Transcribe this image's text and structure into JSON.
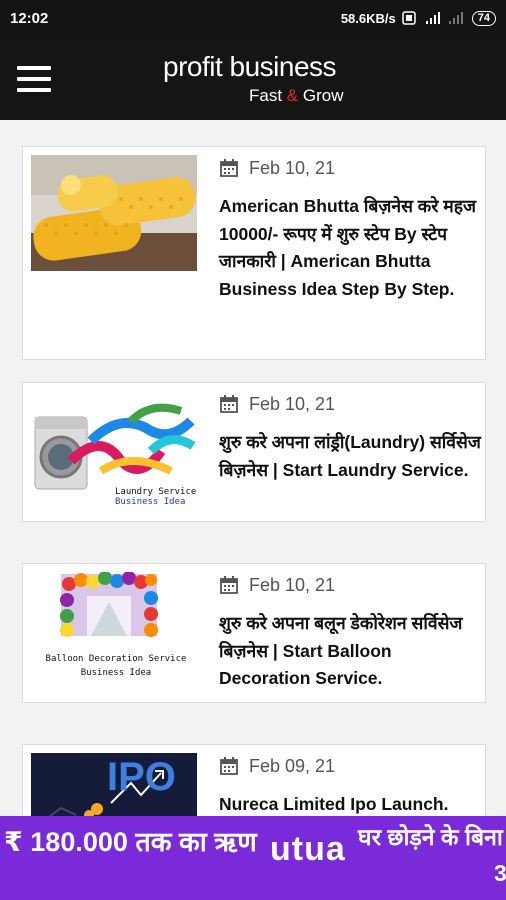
{
  "status_bar": {
    "time": "12:02",
    "network_speed": "58.6KB/s",
    "battery": "74"
  },
  "header": {
    "title": "profit business",
    "tagline_left": "Fast",
    "tagline_amp": "&",
    "tagline_right": "Grow"
  },
  "posts": [
    {
      "date": "Feb 10, 21",
      "title": "American Bhutta बिज़नेस करे महज 10000/- रूपए में शुरु स्टेप By स्टेप जानकारी | American Bhutta Business Idea Step By Step.",
      "image": "corn-image"
    },
    {
      "date": "Feb 10, 21",
      "title": "शुरु करे अपना लांड्री(Laundry) सर्विसेज बिज़नेस | Start Laundry Service.",
      "image": "laundry-image",
      "image_caption_1": "Laundry Service",
      "image_caption_2": "Business Idea"
    },
    {
      "date": "Feb 10, 21",
      "title": "शुरु करे अपना बलून डेकोरेशन सर्विसेज बिज़नेस | Start Balloon Decoration Service.",
      "image": "balloon-image",
      "image_caption_1": "Balloon Decoration Service",
      "image_caption_2": "Business Idea"
    },
    {
      "date": "Feb 09, 21",
      "title": "Nureca Limited Ipo Launch.",
      "image": "ipo-image",
      "image_caption_1": "IPO"
    }
  ],
  "ad": {
    "left_text": "₹ 180.000 तक का ऋण",
    "brand": "utua",
    "right_text": "घर छोड़ने के बिना",
    "trailing_digit": "3"
  },
  "colors": {
    "header_bg": "#151515",
    "accent_red": "#e1261c",
    "ad_purple": "#7b2ad9"
  }
}
